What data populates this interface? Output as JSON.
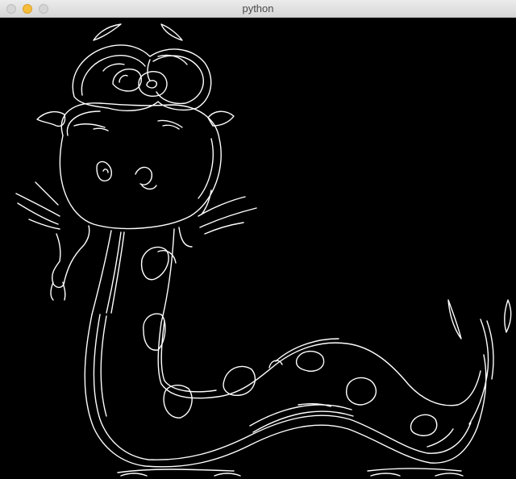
{
  "window": {
    "title": "python",
    "controls": [
      "close",
      "minimize",
      "zoom"
    ]
  },
  "canvas": {
    "background": "#000000",
    "stroke_color": "#ffffff"
  }
}
